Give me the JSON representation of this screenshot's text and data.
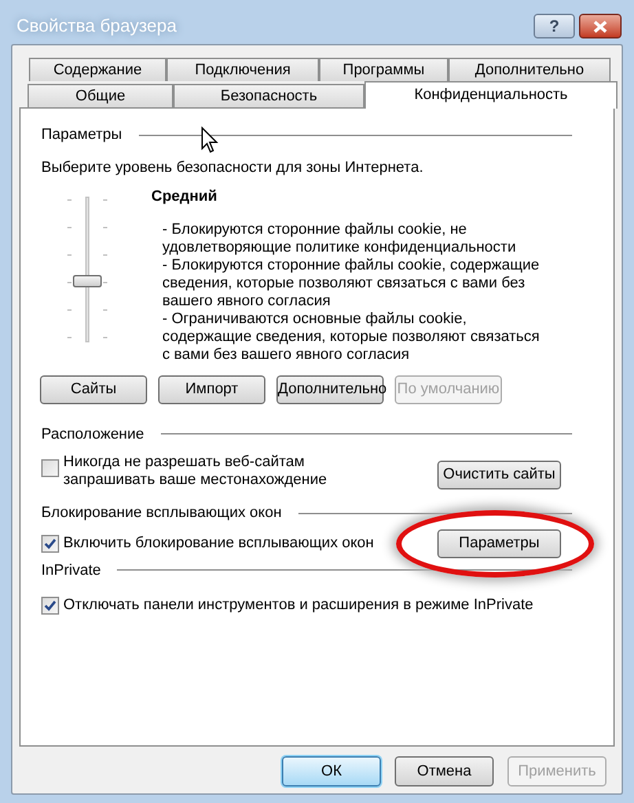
{
  "window": {
    "title": "Свойства браузера",
    "help_button": "?"
  },
  "tab_rows": [
    [
      {
        "label": "Содержание",
        "selected": false
      },
      {
        "label": "Подключения",
        "selected": false
      },
      {
        "label": "Программы",
        "selected": false
      },
      {
        "label": "Дополнительно",
        "selected": false
      }
    ],
    [
      {
        "label": "Общие",
        "selected": false
      },
      {
        "label": "Безопасность",
        "selected": false
      },
      {
        "label": "Конфиденциальность",
        "selected": true
      }
    ]
  ],
  "settings": {
    "heading": "Параметры",
    "instruction": "Выберите уровень безопасности для зоны Интернета.",
    "slider": {
      "level": 0.4
    },
    "level_name": "Средний",
    "description": [
      "- Блокируются сторонние файлы cookie, не удовлетворяющие политике конфиденциальности",
      "- Блокируются сторонние файлы cookie, содержащие сведения, которые позволяют связаться с вами без вашего явного согласия",
      "- Ограничиваются основные файлы cookie, содержащие сведения, которые позволяют связаться с вами без вашего явного согласия"
    ],
    "buttons": [
      {
        "label": "Сайты",
        "disabled": false
      },
      {
        "label": "Импорт",
        "disabled": false
      },
      {
        "label": "Дополнительно",
        "disabled": false
      },
      {
        "label": "По умолчанию",
        "disabled": true
      }
    ]
  },
  "location": {
    "heading": "Расположение",
    "checkbox": {
      "label": "Никогда не разрешать веб-сайтам запрашивать ваше местонахождение",
      "checked": false
    },
    "button": {
      "label": "Очистить сайты",
      "disabled": false
    }
  },
  "popup_blocker": {
    "heading": "Блокирование всплывающих окон",
    "checkbox": {
      "label": "Включить блокирование всплывающих окон",
      "checked": true
    },
    "button": {
      "label": "Параметры",
      "disabled": false,
      "highlighted": true
    }
  },
  "inprivate": {
    "heading": "InPrivate",
    "checkbox": {
      "label": "Отключать панели инструментов и расширения в режиме InPrivate",
      "checked": true
    }
  },
  "footer_buttons": [
    {
      "label": "ОК",
      "disabled": false,
      "default": true
    },
    {
      "label": "Отмена",
      "disabled": false,
      "default": false
    },
    {
      "label": "Применить",
      "disabled": true,
      "default": false
    }
  ]
}
